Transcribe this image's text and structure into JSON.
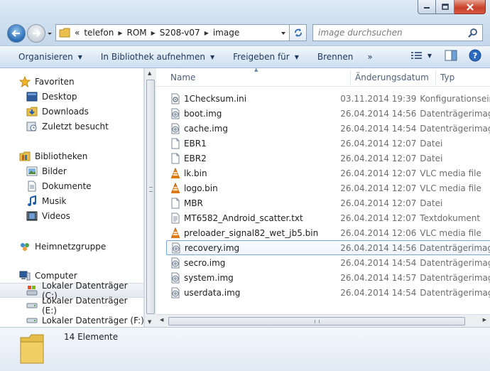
{
  "window": {
    "buttons": {
      "minimize": "minimize-icon",
      "maximize": "maximize-icon",
      "close": "close-icon"
    }
  },
  "address": {
    "crumbs": [
      "telefon",
      "ROM",
      "S208-v07",
      "image"
    ],
    "overflow": "«"
  },
  "search": {
    "placeholder": "image durchsuchen"
  },
  "toolbar": {
    "organize": "Organisieren",
    "library": "In Bibliothek aufnehmen",
    "share": "Freigeben für",
    "burn": "Brennen",
    "more": "»"
  },
  "nav": {
    "favorites": {
      "label": "Favoriten",
      "items": [
        "Desktop",
        "Downloads",
        "Zuletzt besucht"
      ]
    },
    "libraries": {
      "label": "Bibliotheken",
      "items": [
        "Bilder",
        "Dokumente",
        "Musik",
        "Videos"
      ]
    },
    "homegroup": "Heimnetzgruppe",
    "computer": {
      "label": "Computer",
      "items": [
        "Lokaler Datenträger (C:)",
        "Lokaler Datenträger (E:)",
        "Lokaler Datenträger (F:)"
      ]
    }
  },
  "columns": {
    "name": "Name",
    "date": "Änderungsdatum",
    "type": "Typ"
  },
  "files": [
    {
      "name": "1Checksum.ini",
      "date": "03.11.2014 19:39",
      "type": "Konfigurationseinstellungen",
      "icon": "settings-file"
    },
    {
      "name": "boot.img",
      "date": "26.04.2014 14:56",
      "type": "Datenträgerimagedatei",
      "icon": "disc-image"
    },
    {
      "name": "cache.img",
      "date": "26.04.2014 14:54",
      "type": "Datenträgerimagedatei",
      "icon": "disc-image"
    },
    {
      "name": "EBR1",
      "date": "26.04.2014 12:07",
      "type": "Datei",
      "icon": "blank-file"
    },
    {
      "name": "EBR2",
      "date": "26.04.2014 12:07",
      "type": "Datei",
      "icon": "blank-file"
    },
    {
      "name": "lk.bin",
      "date": "26.04.2014 12:07",
      "type": "VLC media file",
      "icon": "vlc-cone"
    },
    {
      "name": "logo.bin",
      "date": "26.04.2014 12:07",
      "type": "VLC media file",
      "icon": "vlc-cone"
    },
    {
      "name": "MBR",
      "date": "26.04.2014 12:07",
      "type": "Datei",
      "icon": "blank-file"
    },
    {
      "name": "MT6582_Android_scatter.txt",
      "date": "26.04.2014 12:07",
      "type": "Textdokument",
      "icon": "text-file"
    },
    {
      "name": "preloader_signal82_wet_jb5.bin",
      "date": "26.04.2014 12:06",
      "type": "VLC media file",
      "icon": "vlc-cone"
    },
    {
      "name": "recovery.img",
      "date": "26.04.2014 14:56",
      "type": "Datenträgerimagedatei",
      "icon": "disc-image"
    },
    {
      "name": "secro.img",
      "date": "26.04.2014 14:54",
      "type": "Datenträgerimagedatei",
      "icon": "disc-image"
    },
    {
      "name": "system.img",
      "date": "26.04.2014 14:57",
      "type": "Datenträgerimagedatei",
      "icon": "disc-image"
    },
    {
      "name": "userdata.img",
      "date": "26.04.2014 14:54",
      "type": "Datenträgerimagedatei",
      "icon": "disc-image"
    }
  ],
  "details": {
    "count": "14 Elemente"
  }
}
